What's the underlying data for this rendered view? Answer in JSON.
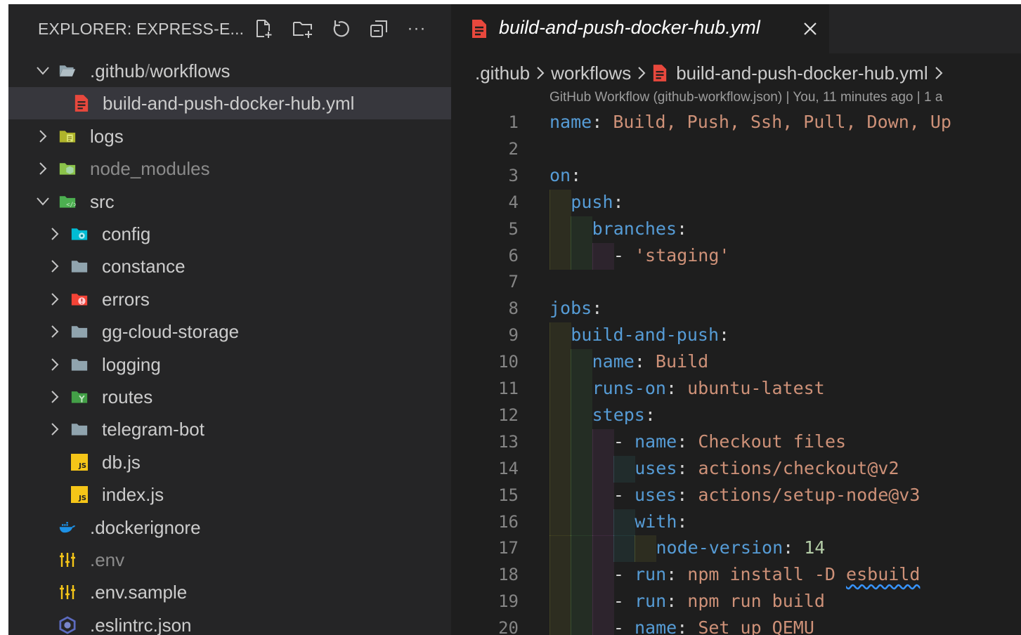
{
  "explorer": {
    "title": "EXPLORER: EXPRESS-E...",
    "toolbar_icons": [
      "new-file-icon",
      "new-folder-icon",
      "refresh-icon",
      "collapse-all-icon",
      "more-icon"
    ],
    "more_label": "···",
    "tree": [
      {
        "id": "github",
        "label": ".github",
        "label2": "workflows",
        "sep": "/",
        "type": "folder-open",
        "expanded": true,
        "depth": 0
      },
      {
        "id": "yml",
        "label": "build-and-push-docker-hub.yml",
        "type": "yml-file",
        "depth": 1,
        "selected": true
      },
      {
        "id": "logs",
        "label": "logs",
        "type": "folder-logs",
        "expanded": false,
        "depth": 0
      },
      {
        "id": "node_modules",
        "label": "node_modules",
        "type": "folder-node",
        "expanded": false,
        "depth": 0,
        "dim": true
      },
      {
        "id": "src",
        "label": "src",
        "type": "folder-src",
        "expanded": true,
        "depth": 0
      },
      {
        "id": "config",
        "label": "config",
        "type": "folder-config",
        "expanded": false,
        "depth": 1
      },
      {
        "id": "constance",
        "label": "constance",
        "type": "folder",
        "expanded": false,
        "depth": 1
      },
      {
        "id": "errors",
        "label": "errors",
        "type": "folder-errors",
        "expanded": false,
        "depth": 1
      },
      {
        "id": "gg-cloud-storage",
        "label": "gg-cloud-storage",
        "type": "folder",
        "expanded": false,
        "depth": 1
      },
      {
        "id": "logging",
        "label": "logging",
        "type": "folder",
        "expanded": false,
        "depth": 1
      },
      {
        "id": "routes",
        "label": "routes",
        "type": "folder-routes",
        "expanded": false,
        "depth": 1
      },
      {
        "id": "telegram-bot",
        "label": "telegram-bot",
        "type": "folder",
        "expanded": false,
        "depth": 1
      },
      {
        "id": "db",
        "label": "db.js",
        "type": "js-file",
        "depth": 1
      },
      {
        "id": "index",
        "label": "index.js",
        "type": "js-file",
        "depth": 1
      },
      {
        "id": "dockerignore",
        "label": ".dockerignore",
        "type": "docker-file",
        "depth": 0
      },
      {
        "id": "env",
        "label": ".env",
        "type": "env-file",
        "depth": 0,
        "dim": true
      },
      {
        "id": "envsample",
        "label": ".env.sample",
        "type": "env-file",
        "depth": 0
      },
      {
        "id": "eslintrc",
        "label": ".eslintrc.json",
        "type": "eslint-file",
        "depth": 0
      }
    ],
    "js_badge": "JS"
  },
  "editor": {
    "tab": {
      "label": "build-and-push-docker-hub.yml",
      "close": "×"
    },
    "breadcrumb": [
      ".github",
      "workflows",
      "build-and-push-docker-hub.yml"
    ],
    "codelens": "GitHub Workflow (github-workflow.json) | You, 11 minutes ago | 1 a",
    "colors": {
      "key": "#569cd6",
      "string": "#ce9178",
      "number": "#b5cea8",
      "punct": "#d4d4d4"
    },
    "lines": [
      {
        "n": "1",
        "indent": 0,
        "tokens": [
          [
            "k",
            "name"
          ],
          [
            "p",
            ": "
          ],
          [
            "s",
            "Build, Push, Ssh, Pull, Down, Up"
          ]
        ]
      },
      {
        "n": "2",
        "indent": 0,
        "tokens": []
      },
      {
        "n": "3",
        "indent": 0,
        "tokens": [
          [
            "k",
            "on"
          ],
          [
            "p",
            ":"
          ]
        ]
      },
      {
        "n": "4",
        "indent": 1,
        "tokens": [
          [
            "k",
            "push"
          ],
          [
            "p",
            ":"
          ]
        ]
      },
      {
        "n": "5",
        "indent": 2,
        "tokens": [
          [
            "k",
            "branches"
          ],
          [
            "p",
            ":"
          ]
        ]
      },
      {
        "n": "6",
        "indent": 3,
        "tokens": [
          [
            "p",
            "- "
          ],
          [
            "s",
            "'staging'"
          ]
        ]
      },
      {
        "n": "7",
        "indent": 0,
        "tokens": []
      },
      {
        "n": "8",
        "indent": 0,
        "tokens": [
          [
            "k",
            "jobs"
          ],
          [
            "p",
            ":"
          ]
        ]
      },
      {
        "n": "9",
        "indent": 1,
        "tokens": [
          [
            "k",
            "build-and-push"
          ],
          [
            "p",
            ":"
          ]
        ]
      },
      {
        "n": "10",
        "indent": 2,
        "tokens": [
          [
            "k",
            "name"
          ],
          [
            "p",
            ": "
          ],
          [
            "s",
            "Build"
          ]
        ]
      },
      {
        "n": "11",
        "indent": 2,
        "tokens": [
          [
            "k",
            "runs-on"
          ],
          [
            "p",
            ": "
          ],
          [
            "s",
            "ubuntu-latest"
          ]
        ]
      },
      {
        "n": "12",
        "indent": 2,
        "tokens": [
          [
            "k",
            "steps"
          ],
          [
            "p",
            ":"
          ]
        ]
      },
      {
        "n": "13",
        "indent": 3,
        "tokens": [
          [
            "p",
            "- "
          ],
          [
            "k",
            "name"
          ],
          [
            "p",
            ": "
          ],
          [
            "s",
            "Checkout files"
          ]
        ]
      },
      {
        "n": "14",
        "indent": 4,
        "tokens": [
          [
            "k",
            "uses"
          ],
          [
            "p",
            ": "
          ],
          [
            "s",
            "actions/checkout@v2"
          ]
        ]
      },
      {
        "n": "15",
        "indent": 3,
        "tokens": [
          [
            "p",
            "- "
          ],
          [
            "k",
            "uses"
          ],
          [
            "p",
            ": "
          ],
          [
            "s",
            "actions/setup-node@v3"
          ]
        ]
      },
      {
        "n": "16",
        "indent": 4,
        "tokens": [
          [
            "k",
            "with"
          ],
          [
            "p",
            ":"
          ]
        ]
      },
      {
        "n": "17",
        "indent": 5,
        "tokens": [
          [
            "k",
            "node-version"
          ],
          [
            "p",
            ": "
          ],
          [
            "n",
            "14"
          ]
        ]
      },
      {
        "n": "18",
        "indent": 3,
        "tokens": [
          [
            "p",
            "- "
          ],
          [
            "k",
            "run"
          ],
          [
            "p",
            ": "
          ],
          [
            "s",
            "npm install -D "
          ],
          [
            "sq",
            "esbuild"
          ]
        ]
      },
      {
        "n": "19",
        "indent": 3,
        "tokens": [
          [
            "p",
            "- "
          ],
          [
            "k",
            "run"
          ],
          [
            "p",
            ": "
          ],
          [
            "s",
            "npm run build"
          ]
        ]
      },
      {
        "n": "20",
        "indent": 3,
        "tokens": [
          [
            "p",
            "- "
          ],
          [
            "k",
            "name"
          ],
          [
            "p",
            ": "
          ],
          [
            "s",
            "Set up QEMU"
          ]
        ]
      }
    ]
  }
}
